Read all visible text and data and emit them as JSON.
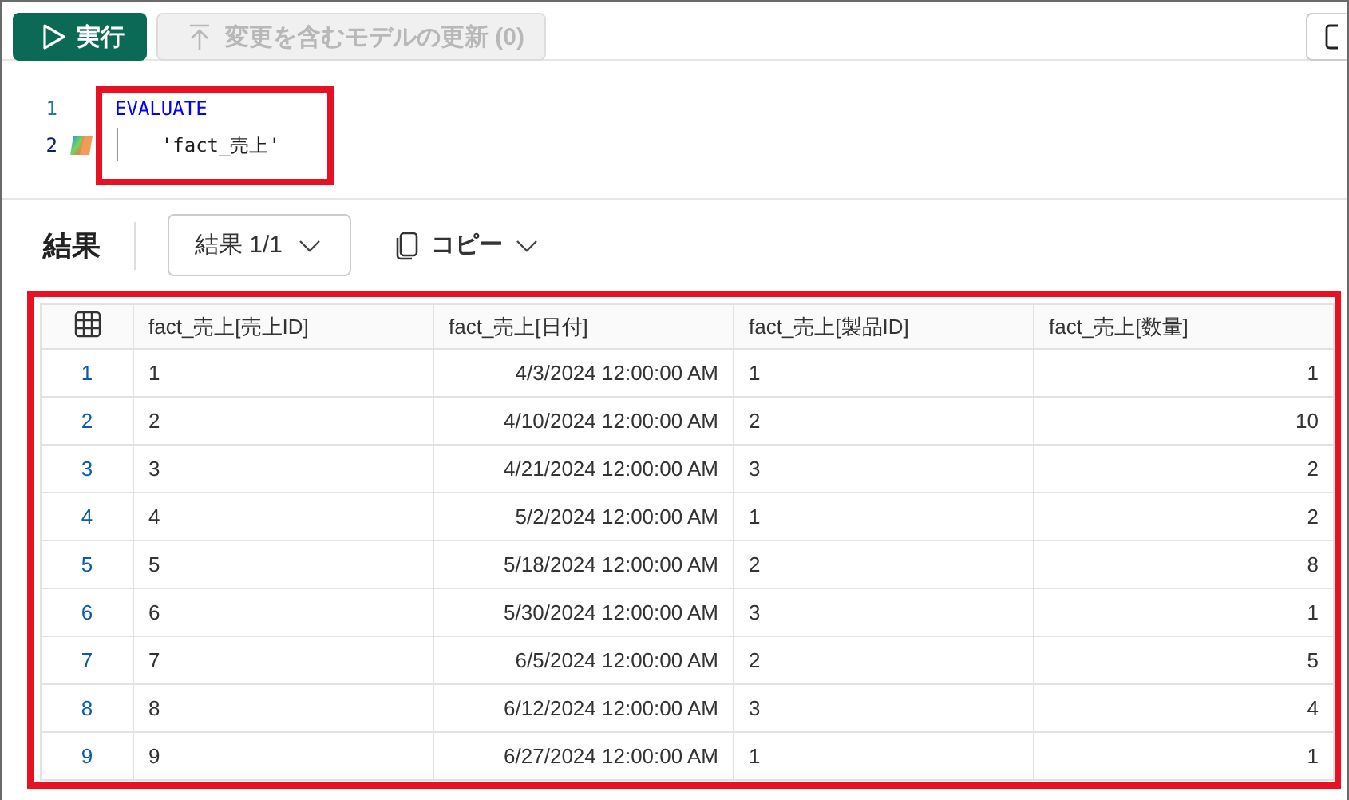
{
  "toolbar": {
    "run_button": "実行",
    "update_button": {
      "label": "変更を含むモデルの更新 (0)",
      "disabled": true
    }
  },
  "editor": {
    "lines": [
      {
        "number": "1",
        "code": "EVALUATE",
        "kind": "keyword"
      },
      {
        "number": "2",
        "code": "    'fact_売上'",
        "kind": "string"
      }
    ]
  },
  "results": {
    "title": "結果",
    "result_picker": "結果 1/1",
    "copy_button": "コピー",
    "table": {
      "columns": [
        {
          "label": "fact_売上[売上ID]",
          "kind": "id"
        },
        {
          "label": "fact_売上[日付]",
          "kind": "date"
        },
        {
          "label": "fact_売上[製品ID]",
          "kind": "id"
        },
        {
          "label": "fact_売上[数量]",
          "kind": "number"
        }
      ],
      "rows": [
        {
          "number": "1",
          "cells": [
            "1",
            "4/3/2024 12:00:00 AM",
            "1",
            "1"
          ]
        },
        {
          "number": "2",
          "cells": [
            "2",
            "4/10/2024 12:00:00 AM",
            "2",
            "10"
          ]
        },
        {
          "number": "3",
          "cells": [
            "3",
            "4/21/2024 12:00:00 AM",
            "3",
            "2"
          ]
        },
        {
          "number": "4",
          "cells": [
            "4",
            "5/2/2024 12:00:00 AM",
            "1",
            "2"
          ]
        },
        {
          "number": "5",
          "cells": [
            "5",
            "5/18/2024 12:00:00 AM",
            "2",
            "8"
          ]
        },
        {
          "number": "6",
          "cells": [
            "6",
            "5/30/2024 12:00:00 AM",
            "3",
            "1"
          ]
        },
        {
          "number": "7",
          "cells": [
            "7",
            "6/5/2024 12:00:00 AM",
            "2",
            "5"
          ]
        },
        {
          "number": "8",
          "cells": [
            "8",
            "6/12/2024 12:00:00 AM",
            "3",
            "4"
          ]
        },
        {
          "number": "9",
          "cells": [
            "9",
            "6/27/2024 12:00:00 AM",
            "1",
            "1"
          ]
        }
      ]
    }
  }
}
